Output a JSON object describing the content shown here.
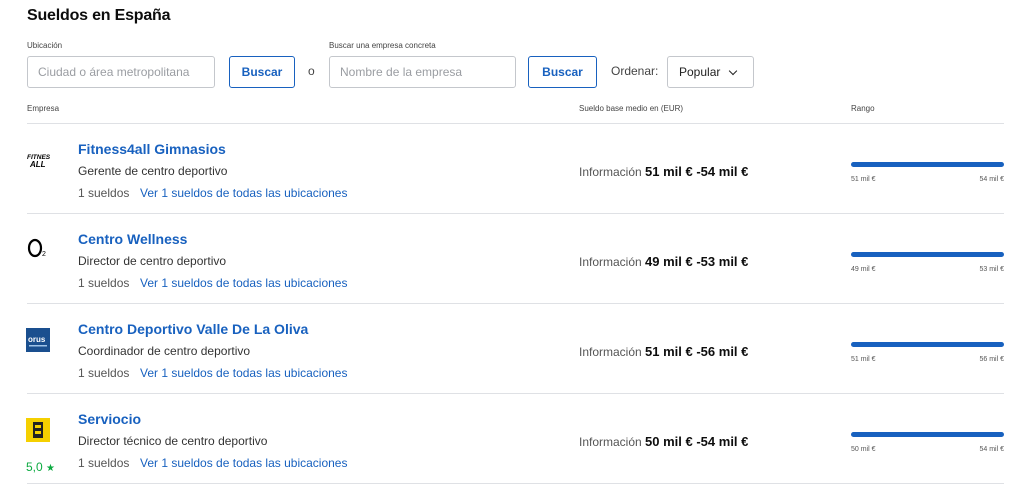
{
  "page": {
    "title": "Sueldos en España"
  },
  "search": {
    "location_label": "Ubicación",
    "location_placeholder": "Ciudad o área metropolitana",
    "location_button": "Buscar",
    "or_text": "o",
    "company_label": "Buscar una empresa concreta",
    "company_placeholder": "Nombre de la empresa",
    "company_button": "Buscar",
    "sort_label": "Ordenar:",
    "sort_value": "Popular"
  },
  "table": {
    "headers": {
      "company": "Empresa",
      "salary": "Sueldo base medio en (EUR)",
      "range": "Rango"
    },
    "rows": [
      {
        "company": "Fitness4all Gimnasios",
        "job": "Gerente de centro deportivo",
        "count": "1 sueldos",
        "link": "Ver 1 sueldos de todas las ubicaciones",
        "info_prefix": "Información",
        "salary": "51 mil € -54 mil €",
        "range_min": "51 mil €",
        "range_max": "54 mil €",
        "logo": "fitness4all-logo",
        "rating": ""
      },
      {
        "company": "Centro Wellness",
        "job": "Director de centro deportivo",
        "count": "1 sueldos",
        "link": "Ver 1 sueldos de todas las ubicaciones",
        "info_prefix": "Información",
        "salary": "49 mil € -53 mil €",
        "range_min": "49 mil €",
        "range_max": "53 mil €",
        "logo": "o2-logo",
        "rating": ""
      },
      {
        "company": "Centro Deportivo Valle De La Oliva",
        "job": "Coordinador de centro deportivo",
        "count": "1 sueldos",
        "link": "Ver 1 sueldos de todas las ubicaciones",
        "info_prefix": "Información",
        "salary": "51 mil € -56 mil €",
        "range_min": "51 mil €",
        "range_max": "56 mil €",
        "logo": "forus-logo",
        "rating": ""
      },
      {
        "company": "Serviocio",
        "job": "Director técnico de centro deportivo",
        "count": "1 sueldos",
        "link": "Ver 1 sueldos de todas las ubicaciones",
        "info_prefix": "Información",
        "salary": "50 mil € -54 mil €",
        "range_min": "50 mil €",
        "range_max": "54 mil €",
        "logo": "serviocio-logo",
        "rating": "5,0"
      }
    ]
  },
  "colors": {
    "accent": "#1861bf",
    "rating": "#0caa41"
  }
}
